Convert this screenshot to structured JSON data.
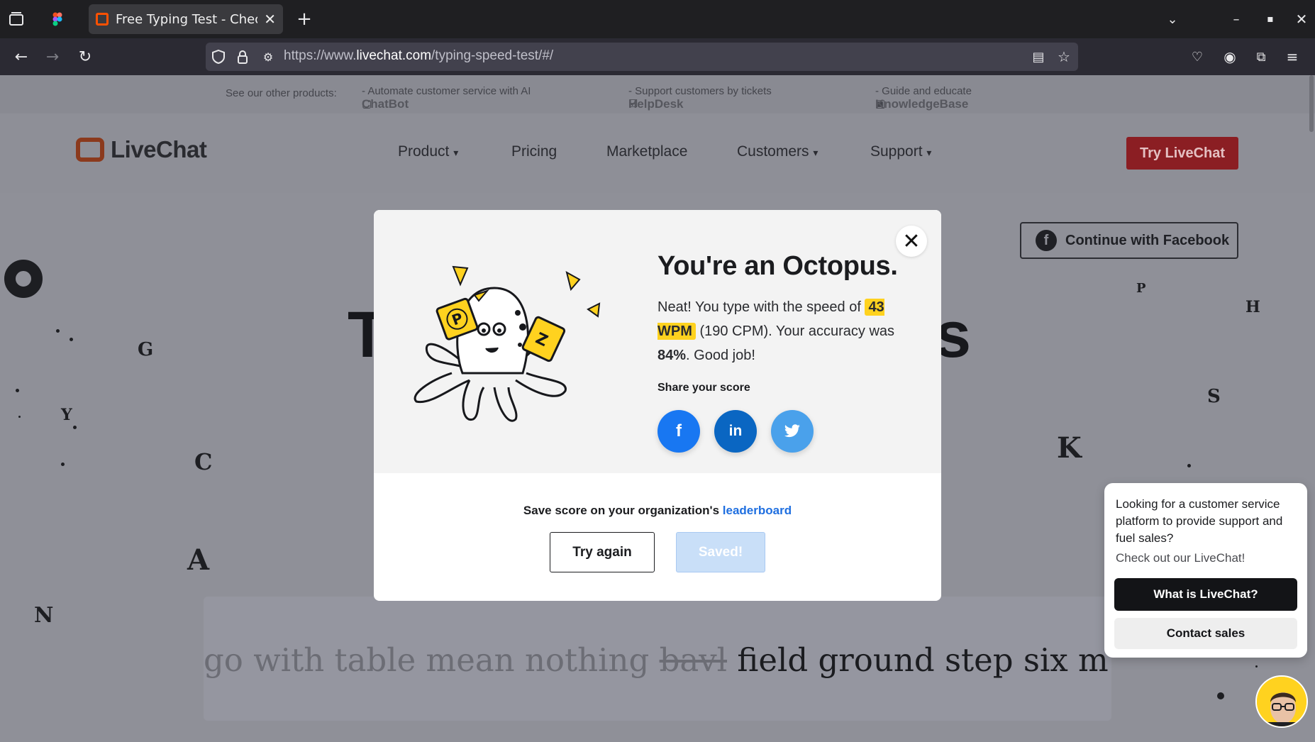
{
  "browser": {
    "tab_title": "Free Typing Test - Check",
    "url_prefix": "https://www.",
    "url_domain": "livechat.com",
    "url_path": "/typing-speed-test/#/"
  },
  "promo": {
    "label": "See our other products:",
    "products": [
      {
        "name": "ChatBot",
        "desc": "- Automate customer service with AI"
      },
      {
        "name": "HelpDesk",
        "desc": "- Support customers by tickets"
      },
      {
        "name": "KnowledgeBase",
        "desc": "- Guide and educate"
      }
    ]
  },
  "header": {
    "logo": "LiveChat",
    "nav": [
      "Product",
      "Pricing",
      "Marketplace",
      "Customers",
      "Support"
    ],
    "nav_caret": "▾",
    "cta": "Try LiveChat",
    "facebook": "Continue with Facebook"
  },
  "modal": {
    "title": "You're an Octopus.",
    "text_1": "Neat! You type with the speed of ",
    "wpm": "43 WPM",
    "text_2": " (190 CPM). Your accuracy was ",
    "accuracy": "84%",
    "text_3": ". Good job!",
    "share_label": "Share your score",
    "save_prefix": "Save score on your organization's ",
    "save_link": "leaderboard",
    "try_again": "Try again",
    "saved": "Saved!",
    "close": "✕"
  },
  "typing": {
    "typed": "go with table mean nothing ",
    "wrong": "bavl",
    "upcoming": " field ground step six much and w"
  },
  "chat": {
    "message": "Looking for a customer service platform to provide support and fuel sales?",
    "sub": "Check out our LiveChat!",
    "primary": "What is LiveChat?",
    "secondary": "Contact sales"
  },
  "colors": {
    "accent_red": "#d4202f",
    "highlight_yellow": "#ffd21f",
    "link_blue": "#1f6fe0",
    "facebook_blue": "#1877f2",
    "linkedin_blue": "#0a66c2",
    "twitter_blue": "#4aa1eb"
  },
  "icons": {
    "facebook": "f",
    "linkedin": "in",
    "twitter": "twitter-bird"
  }
}
